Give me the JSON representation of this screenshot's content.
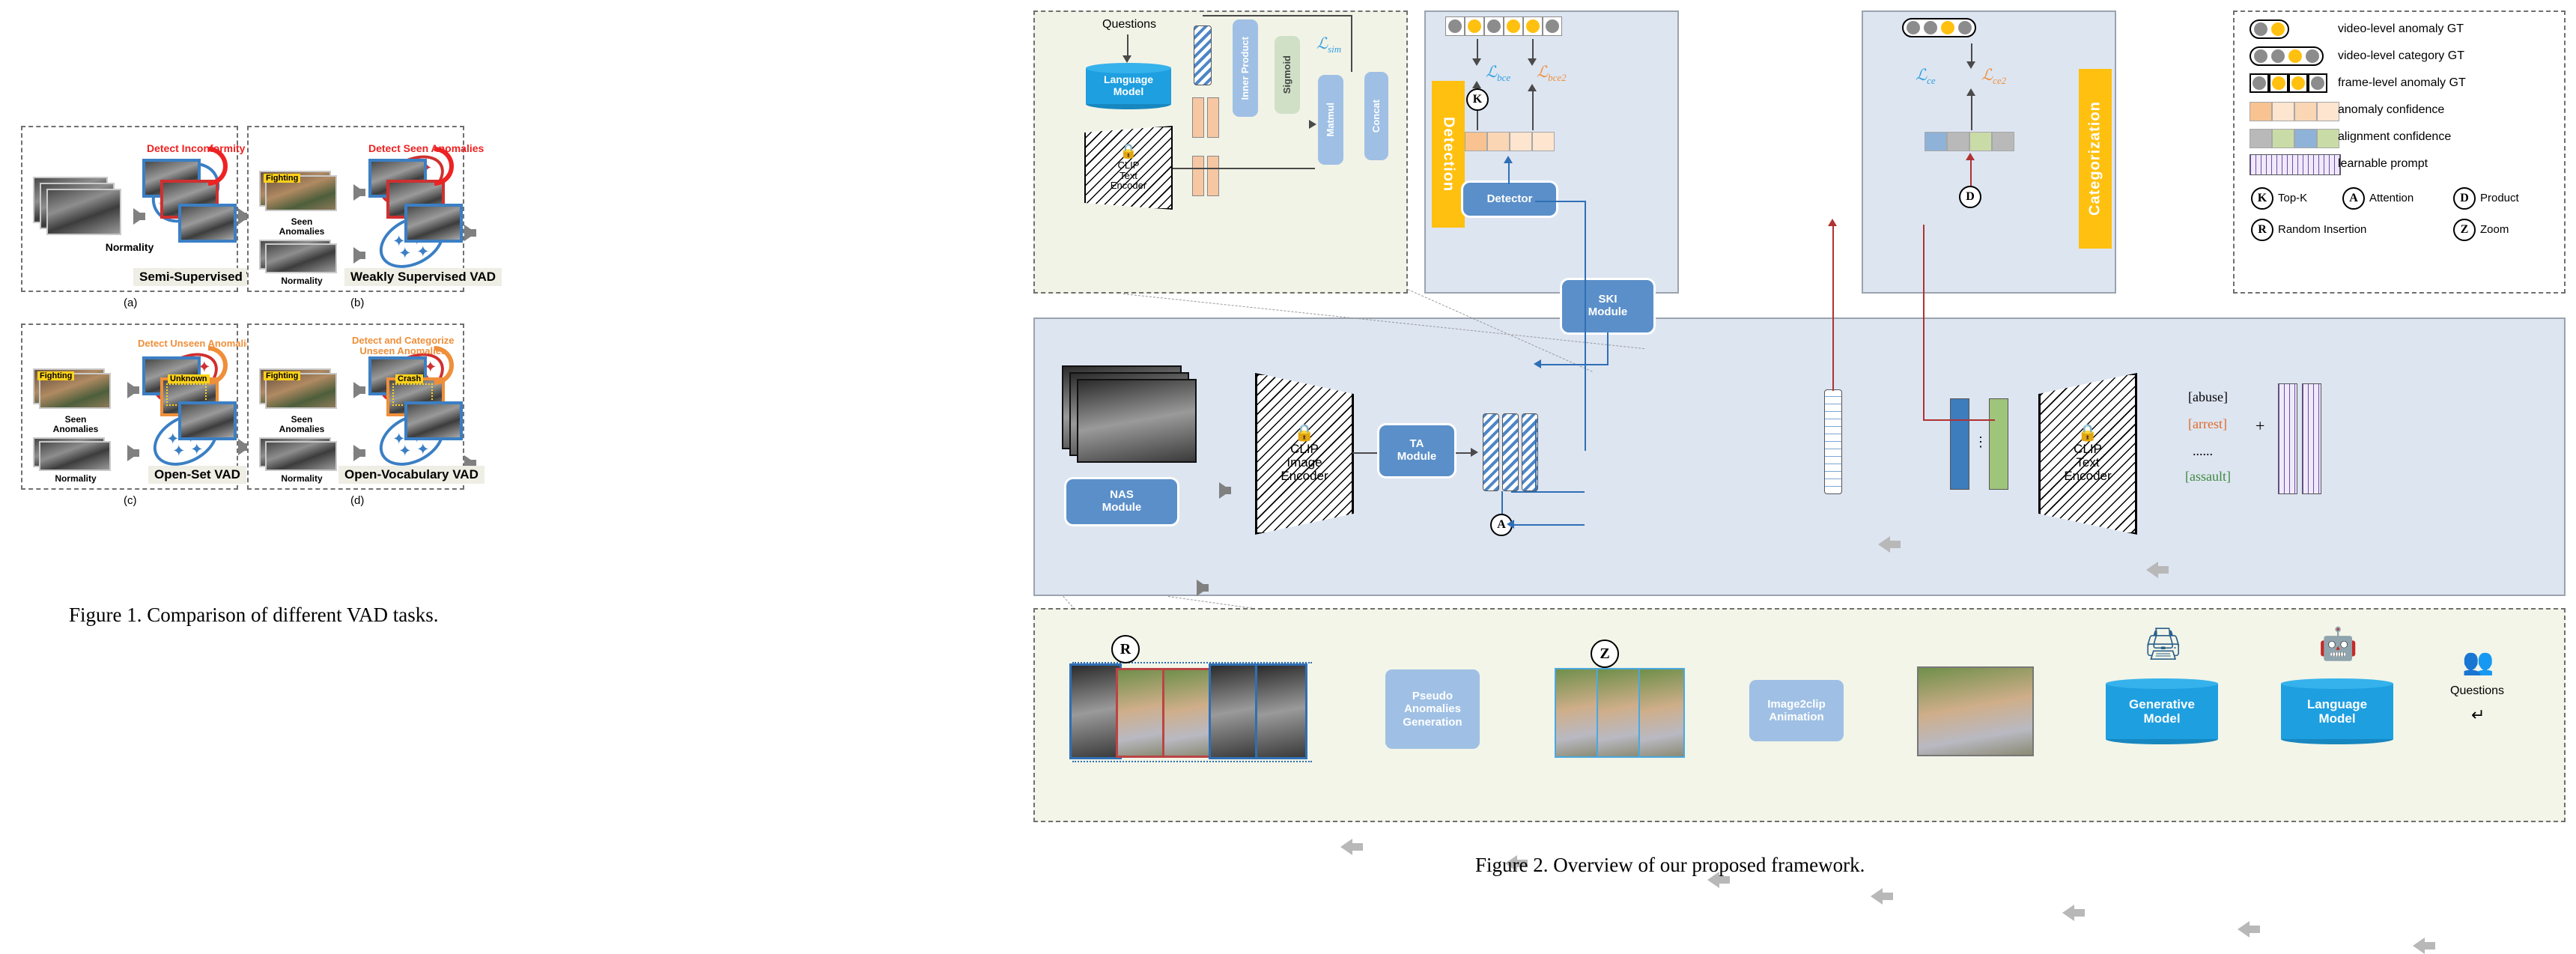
{
  "figure1": {
    "caption": "Figure 1. Comparison of different VAD tasks.",
    "panels": [
      {
        "id": "(a)",
        "tag": "Semi-Supervised VAD",
        "left_labels": [
          "Normality"
        ],
        "action_text": "Detect Inconformity",
        "action_color": "#ee2222"
      },
      {
        "id": "(b)",
        "tag": "Weakly Supervised VAD",
        "left_labels": [
          "Seen\nAnomalies",
          "Normality"
        ],
        "badge_label": "Fighting",
        "action_text": "Detect Seen Anomalies",
        "action_color": "#ee2222"
      },
      {
        "id": "(c)",
        "tag": "Open-Set VAD",
        "left_labels": [
          "Seen\nAnomalies",
          "Normality"
        ],
        "badge_label": "Fighting",
        "action_text": "Detect Unseen Anomalies",
        "action_color": "#ef8f3a",
        "thumb_label": "Unknown"
      },
      {
        "id": "(d)",
        "tag": "Open-Vocabulary VAD",
        "left_labels": [
          "Seen\nAnomalies",
          "Normality"
        ],
        "badge_label": "Fighting",
        "action_text": "Detect and Categorize\nUnseen Anomalies",
        "action_color": "#ef8f3a",
        "thumb_label": "Crash"
      }
    ]
  },
  "figure2": {
    "caption": "Figure 2. Overview of our proposed framework.",
    "ski_panel": {
      "questions_label": "Questions",
      "language_model": "Language\nModel",
      "clip_text_encoder": "CLIP\nText\nEncoder",
      "inner_product": "Inner Product",
      "sigmoid": "Sigmoid",
      "matmul": "Matmul",
      "concat": "Concat",
      "loss": "L_sim"
    },
    "detection_panel": {
      "title": "Detection",
      "loss_bce": "L_bce",
      "loss_bce2": "L_bce2",
      "topk_badge": "K",
      "detector_label": "Detector",
      "gt_dots": [
        "grey",
        "yellow",
        "grey",
        "yellow",
        "yellow",
        "grey"
      ],
      "confidence_cells": [
        "c1",
        "c3",
        "c2",
        "c2"
      ]
    },
    "categorization_panel": {
      "title": "Categorization",
      "loss_ce": "L_ce",
      "loss_ce2": "L_ce2",
      "product_badge": "D",
      "gt_dots": [
        "grey",
        "grey",
        "yellow",
        "grey"
      ],
      "align_cells": [
        "a3",
        "a1",
        "a2",
        "a1"
      ]
    },
    "main_panel": {
      "ski_module": "SKI\nModule",
      "nas_module": "NAS\nModule",
      "clip_image_encoder": "CLIP\nImage\nEncoder",
      "ta_module": "TA\nModule",
      "clip_text_encoder": "CLIP\nText\nEncoder",
      "attention_badge": "A",
      "class_words": [
        "[abuse]",
        "[arrest]",
        "......",
        "[assault]"
      ],
      "plus_sign": "+"
    },
    "generation_panel": {
      "pseudo_anomalies": "Pseudo\nAnomalies\nGeneration",
      "image2clip": "Image2clip\nAnimation",
      "generative_model": "Generative\nModel",
      "language_model": "Language\nModel",
      "questions_label": "Questions",
      "random_insert_badge": "R",
      "zoom_badge": "Z"
    },
    "legend": {
      "rows": [
        {
          "label": "video-level anomaly GT",
          "symbol": "pill-dots-2"
        },
        {
          "label": "video-level category GT",
          "symbol": "pill-dots-4"
        },
        {
          "label": "frame-level anomaly GT",
          "symbol": "box-dots-4"
        },
        {
          "label": "anomaly confidence",
          "symbol": "conf-cells"
        },
        {
          "label": "alignment confidence",
          "symbol": "align-cells"
        },
        {
          "label": "learnable prompt",
          "symbol": "prompt-grid"
        }
      ],
      "symbols": [
        {
          "mark": "K",
          "label": "Top-K"
        },
        {
          "mark": "A",
          "label": "Attention"
        },
        {
          "mark": "D",
          "label": "Product"
        },
        {
          "mark": "R",
          "label": "Random Insertion"
        },
        {
          "mark": "Z",
          "label": "Zoom"
        }
      ]
    }
  }
}
